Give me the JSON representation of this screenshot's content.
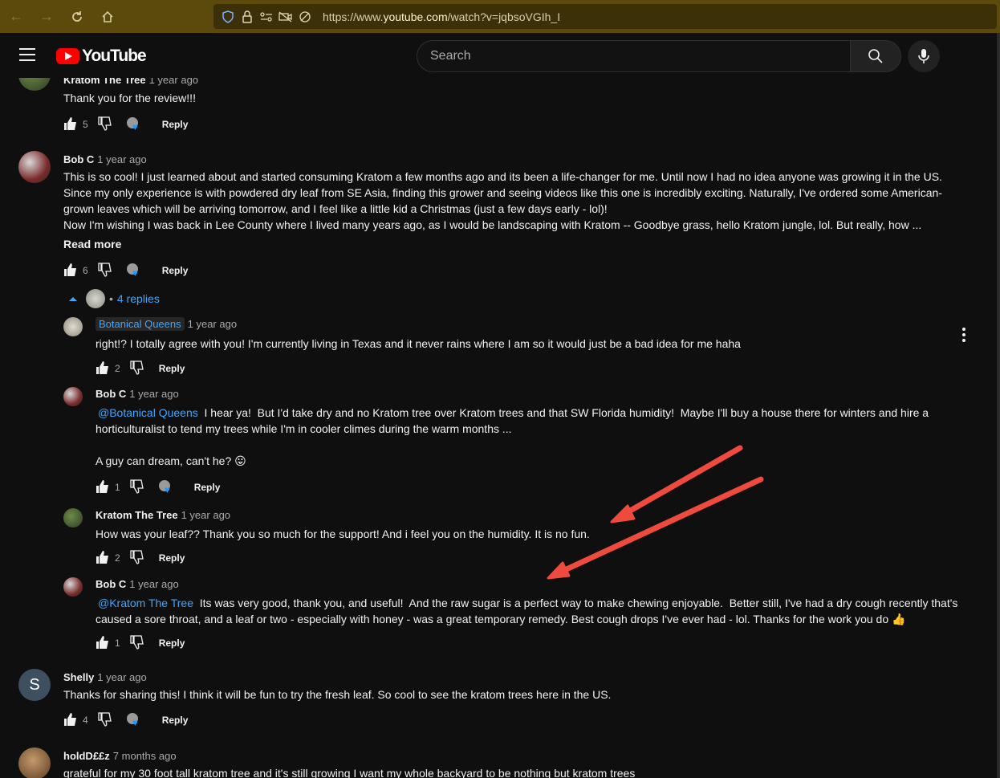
{
  "browser": {
    "url_prefix": "https://www.",
    "url_host": "youtube.com",
    "url_path": "/watch?v=jqbsoVGIh_I"
  },
  "header": {
    "logo_text": "YouTube",
    "search_placeholder": "Search"
  },
  "comments": [
    {
      "author": "Kratom The Tree",
      "time": "1 year ago",
      "text": "Thank you for the review!!!",
      "likes": "5",
      "reply_label": "Reply"
    },
    {
      "author": "Bob C",
      "time": "1 year ago",
      "lines": [
        "This is so cool!  I just learned about and started consuming Kratom a few months ago and its been a life-changer for me.   Until now I had no idea anyone was growing it in the US.",
        "Since my only experience is with powdered dry leaf from SE Asia, finding this grower and seeing videos like this one is incredibly exciting.  Naturally, I've ordered some American-",
        "grown leaves which will be arriving tomorrow, and I feel like a little kid a Christmas (just a few days early - lol)!",
        "Now I'm wishing I was back in Lee County where I lived many years ago, as I would be  landscaping with Kratom -- Goodbye grass, hello Kratom jungle, lol.   But really, how ..."
      ],
      "read_more": "Read more",
      "likes": "6",
      "reply_label": "Reply",
      "replies_label": "4 replies"
    },
    {
      "author": "Shelly",
      "avatar_letter": "S",
      "time": "1 year ago",
      "text": "Thanks for sharing this! I think it will be fun to try the fresh leaf. So cool to see the kratom trees here in the US.",
      "likes": "4",
      "reply_label": "Reply"
    },
    {
      "author": "holdD££z",
      "time": "7 months ago",
      "text": "grateful for my 30 foot tall kratom tree and it's still growing I want my whole backyard to be nothing but kratom trees"
    }
  ],
  "replies": [
    {
      "author": "Botanical Queens",
      "time": "1 year ago",
      "text": "right!? I totally agree with you! I'm currently living in Texas and it never rains where I am so it would just be a bad idea for me haha",
      "likes": "2",
      "reply_label": "Reply"
    },
    {
      "author": "Bob C",
      "time": "1 year ago",
      "mention": "@Botanical Queens",
      "line1": "  I hear ya!  But I'd take dry and no Kratom tree over Kratom trees and that SW Florida humidity!  Maybe I'll buy a house there for winters and hire a",
      "line2": "horticulturalist to tend my trees while I'm in cooler climes during the warm months ...",
      "line3": "A guy can dream, can't he? 😛",
      "likes": "1",
      "reply_label": "Reply"
    },
    {
      "author": "Kratom The Tree",
      "time": "1 year ago",
      "text": "How was your leaf?? Thank you so much for the support! And i feel you on the humidity. It is no fun.",
      "likes": "2",
      "reply_label": "Reply"
    },
    {
      "author": "Bob C",
      "time": "1 year ago",
      "mention": "@Kratom The Tree",
      "line1": "  Its was very good, thank you, and useful!  And the raw sugar is a perfect way to make chewing enjoyable.  Better still, I've had a dry cough recently that's",
      "line2": "caused a sore throat, and a leaf or two - especially with honey - was a great temporary remedy.  Best cough drops I've ever had - lol.  Thanks for the work you do 👍",
      "likes": "1",
      "reply_label": "Reply"
    }
  ],
  "colors": {
    "browser_bar": "#5b4a0c",
    "page_bg": "#0f0f0f",
    "link": "#3ea6ff",
    "annotation_arrow": "#ee4b3e"
  }
}
